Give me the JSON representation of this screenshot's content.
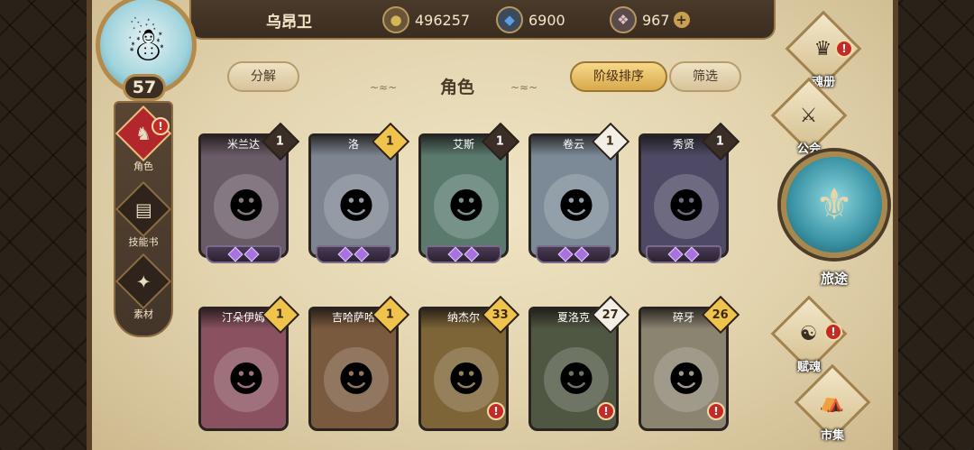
{
  "player": {
    "name": "乌昂卫",
    "level": "57",
    "avatar_icon": "☃"
  },
  "currencies": [
    {
      "icon": "coin-icon",
      "glyph": "●",
      "value": "496257",
      "color": "#d7b655"
    },
    {
      "icon": "crystal-icon",
      "glyph": "◆",
      "value": "6900",
      "color": "#5aa0e6"
    },
    {
      "icon": "gem-icon",
      "glyph": "❖",
      "value": "967",
      "color": "#e8c2c8"
    }
  ],
  "plus_symbol": "+",
  "alert_symbol": "!",
  "left_nav": [
    {
      "label": "角色",
      "glyph": "♞",
      "active": true,
      "alert": true
    },
    {
      "label": "技能书",
      "glyph": "▤",
      "active": false,
      "alert": false
    },
    {
      "label": "素材",
      "glyph": "✦",
      "active": false,
      "alert": false
    }
  ],
  "toolbar": {
    "decompose_label": "分解",
    "title": "角色",
    "sort_label": "阶级排序",
    "filter_label": "筛选"
  },
  "cards": [
    {
      "name": "米兰达",
      "count": "1",
      "badge": "dark",
      "bg": "#6a5c67",
      "glyph": "☻",
      "alert": false
    },
    {
      "name": "洛",
      "count": "1",
      "badge": "gold",
      "bg": "#7d8590",
      "glyph": "☻",
      "alert": false
    },
    {
      "name": "艾斯",
      "count": "1",
      "badge": "dark",
      "bg": "#5a7a6e",
      "glyph": "☻",
      "alert": false
    },
    {
      "name": "卷云",
      "count": "1",
      "badge": "white",
      "bg": "#7c8a97",
      "glyph": "☻",
      "alert": false
    },
    {
      "name": "秀贤",
      "count": "1",
      "badge": "dark",
      "bg": "#4e4a66",
      "glyph": "☻",
      "alert": false
    },
    {
      "name": "汀朵伊姆",
      "count": "1",
      "badge": "gold",
      "bg": "#8a5260",
      "glyph": "☻",
      "alert": false
    },
    {
      "name": "吉哈萨哈",
      "count": "1",
      "badge": "gold",
      "bg": "#7a5a3e",
      "glyph": "☻",
      "alert": false
    },
    {
      "name": "纳杰尔",
      "count": "33",
      "badge": "gold",
      "bg": "#7d6538",
      "glyph": "☻",
      "alert": true
    },
    {
      "name": "夏洛克",
      "count": "27",
      "badge": "white",
      "bg": "#4f5742",
      "glyph": "☻",
      "alert": true
    },
    {
      "name": "碎牙",
      "count": "26",
      "badge": "gold",
      "bg": "#8b8471",
      "glyph": "☻",
      "alert": true
    }
  ],
  "right_nav": [
    {
      "label": "魂册",
      "glyph": "♛",
      "alert": true
    },
    {
      "label": "公会",
      "glyph": "⚔",
      "alert": false
    },
    {
      "label": "赋魂",
      "glyph": "☯",
      "alert": true
    },
    {
      "label": "市集",
      "glyph": "⛺",
      "alert": false
    }
  ],
  "journey": {
    "label": "旅途",
    "glyph": "⚜"
  }
}
